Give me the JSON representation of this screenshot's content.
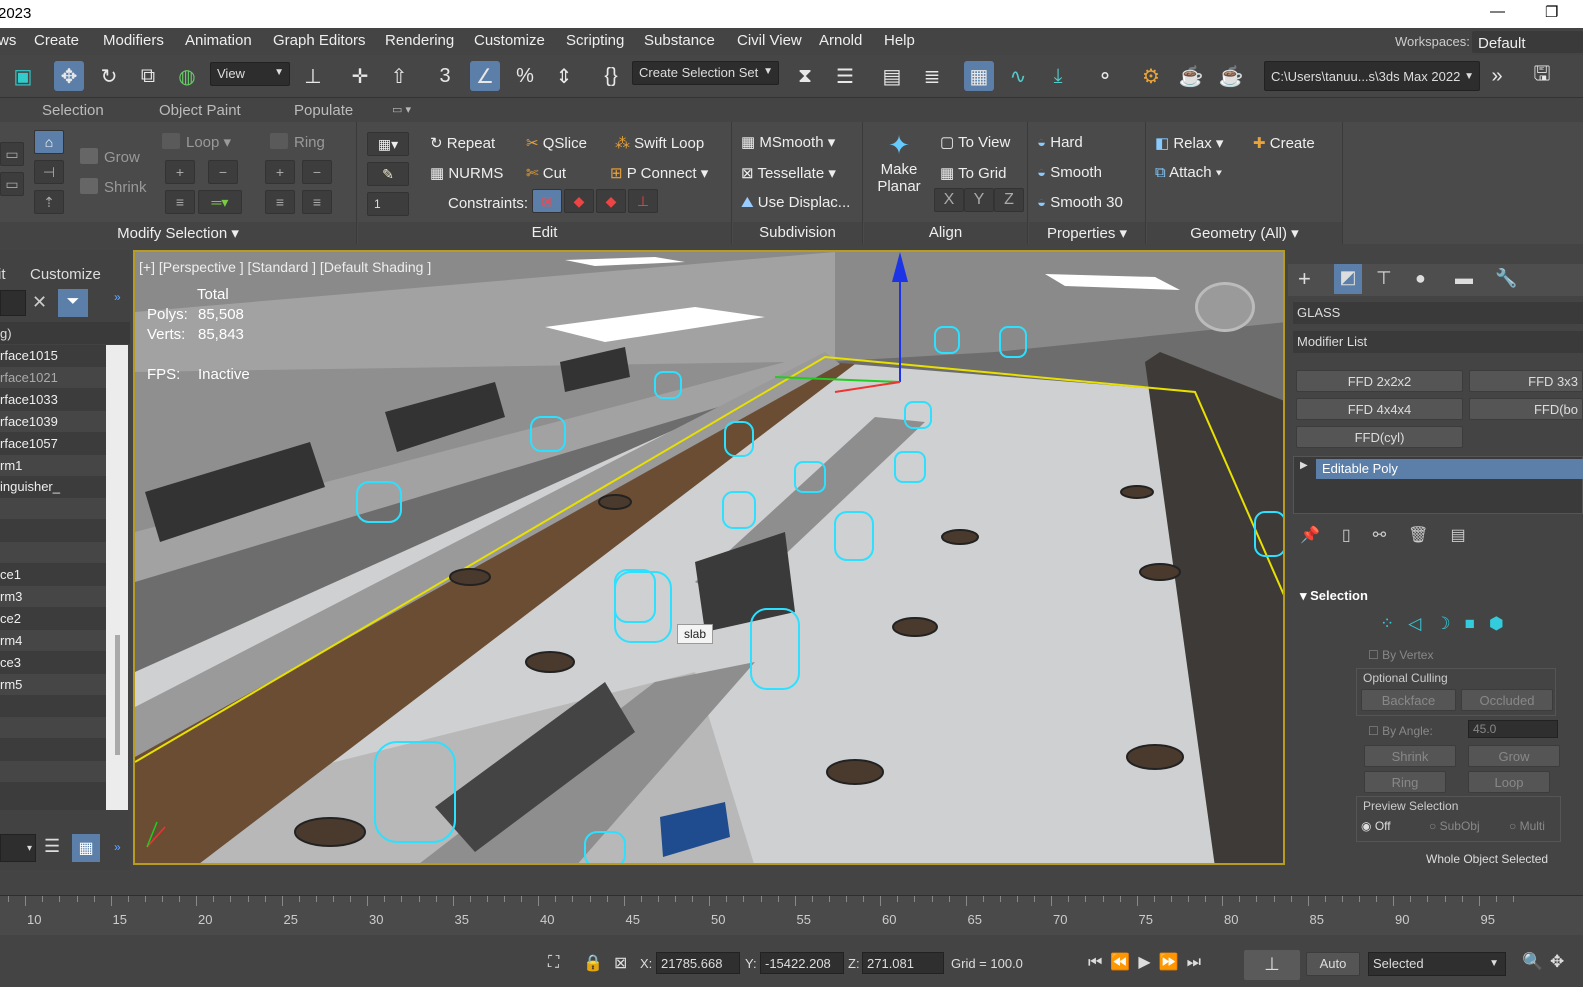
{
  "window": {
    "title": "2023"
  },
  "menu": [
    "ws",
    "Create",
    "Modifiers",
    "Animation",
    "Graph Editors",
    "Rendering",
    "Customize",
    "Scripting",
    "Substance",
    "Civil View",
    "Arnold",
    "Help"
  ],
  "workspaces": {
    "label": "Workspaces:",
    "value": "Default"
  },
  "toolbar": {
    "view_combo": "View",
    "selection_set": "Create Selection Set",
    "path": "C:\\Users\\tanuu...s\\3ds Max 2022"
  },
  "ribbon_tabs": [
    "Selection",
    "Object Paint",
    "Populate"
  ],
  "ribbon": {
    "grow": "Grow",
    "shrink": "Shrink",
    "loop": "Loop",
    "ring": "Ring",
    "spinner_value": "1",
    "repeat": "Repeat",
    "qslice": "QSlice",
    "swift_loop": "Swift Loop",
    "nurms": "NURMS",
    "cut": "Cut",
    "p_connect": "P Connect",
    "constraints": "Constraints:",
    "msmooth": "MSmooth",
    "tessellate": "Tessellate",
    "use_displace": "Use Displac...",
    "make_planar_1": "Make",
    "make_planar_2": "Planar",
    "to_view": "To View",
    "to_grid": "To Grid",
    "x": "X",
    "y": "Y",
    "z": "Z",
    "hard": "Hard",
    "smooth": "Smooth",
    "smooth30": "Smooth 30",
    "relax": "Relax",
    "attach": "Attach",
    "create": "Create",
    "groups": {
      "modify_selection": "Modify Selection",
      "edit": "Edit",
      "subdivision": "Subdivision",
      "align": "Align",
      "properties": "Properties",
      "geometry": "Geometry (All)"
    }
  },
  "scene_explorer": {
    "tabs": [
      "it",
      "Customize"
    ],
    "header": "g)",
    "rows": [
      "rface1015",
      "rface1021",
      "rface1033",
      "rface1039",
      "rface1057",
      "rm1",
      "inguisher_",
      "",
      "",
      "",
      "ce1",
      "rm3",
      "ce2",
      "rm4",
      "ce3",
      "rm5",
      "",
      "",
      "",
      "",
      ""
    ]
  },
  "viewport": {
    "label": "[+] [Perspective ] [Standard ] [Default Shading ]",
    "stats_total": "Total",
    "polys_label": "Polys:",
    "polys_value": "85,508",
    "verts_label": "Verts:",
    "verts_value": "85,843",
    "fps_label": "FPS:",
    "fps_value": "Inactive",
    "tooltip": "slab"
  },
  "command_panel": {
    "object_name": "GLASS",
    "modifier_list": "Modifier List",
    "buttons": [
      "FFD 2x2x2",
      "FFD 3x3",
      "FFD 4x4x4",
      "FFD(bo",
      "FFD(cyl)"
    ],
    "stack_item": "Editable Poly",
    "rollout_title": "Selection",
    "by_vertex": "By Vertex",
    "optional_culling": "Optional Culling",
    "backface": "Backface",
    "occluded": "Occluded",
    "by_angle": "By Angle:",
    "angle_value": "45.0",
    "shrink": "Shrink",
    "grow": "Grow",
    "ring": "Ring",
    "loop": "Loop",
    "preview_selection": "Preview Selection",
    "off": "Off",
    "subobj": "SubObj",
    "multi": "Multi",
    "whole_object": "Whole Object Selected"
  },
  "timeline_ticks": [
    "10",
    "15",
    "20",
    "25",
    "30",
    "35",
    "40",
    "45",
    "50",
    "55",
    "60",
    "65",
    "70",
    "75",
    "80",
    "85",
    "90",
    "95"
  ],
  "status": {
    "x_label": "X:",
    "x": "21785.668",
    "y_label": "Y:",
    "y": "-15422.208",
    "z_label": "Z:",
    "z": "271.081",
    "grid": "Grid = 100.0",
    "auto": "Auto",
    "selected": "Selected"
  },
  "colors": {
    "accent": "#5b7fa8",
    "viewport_border": "#b79c24",
    "selection_cyan": "#2de0ff",
    "bbox_yellow": "#e8e000"
  }
}
